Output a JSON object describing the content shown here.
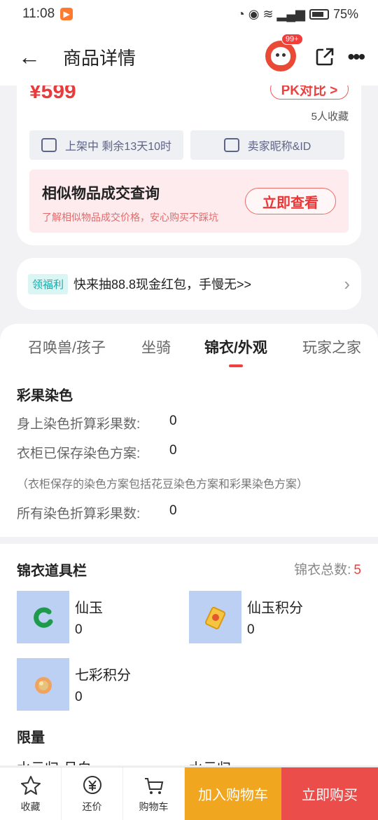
{
  "status": {
    "time": "11:08",
    "battery": "75%",
    "network": "4G"
  },
  "nav": {
    "title": "商品详情",
    "badge": "99+"
  },
  "product": {
    "price": "¥599",
    "pk_label": "PK对比 >",
    "fav_count": "5人收藏",
    "listing_status": "上架中 剩余13天10时",
    "seller": "卖家昵称&ID"
  },
  "similar": {
    "title": "相似物品成交查询",
    "subtitle": "了解相似物品成交价格，安心购买不踩坑",
    "button": "立即查看"
  },
  "promo": {
    "tag": "领福利",
    "text": "快来抽88.8现金红包，手慢无>>"
  },
  "tabs": [
    {
      "label": "召唤兽/孩子"
    },
    {
      "label": "坐骑"
    },
    {
      "label": "锦衣/外观"
    },
    {
      "label": "玩家之家"
    }
  ],
  "dye": {
    "title": "彩果染色",
    "rows": [
      {
        "label": "身上染色折算彩果数:",
        "value": "0"
      },
      {
        "label": "衣柜已保存染色方案:",
        "value": "0"
      },
      {
        "label": "所有染色折算彩果数:",
        "value": "0"
      }
    ],
    "note": "（衣柜保存的染色方案包括花豆染色方案和彩果染色方案）"
  },
  "wardrobe": {
    "title": "锦衣道具栏",
    "total_label": "锦衣总数:",
    "total_value": "5",
    "items": [
      {
        "name": "仙玉",
        "value": "0",
        "icon": "jade-icon"
      },
      {
        "name": "仙玉积分",
        "value": "0",
        "icon": "jade-points-icon"
      },
      {
        "name": "七彩积分",
        "value": "0",
        "icon": "rainbow-points-icon"
      }
    ],
    "limited_title": "限量",
    "partial_1": "水云归·月白",
    "partial_2": "水云归"
  },
  "bottom": {
    "fav": "收藏",
    "bargain": "还价",
    "cart": "购物车",
    "add_cart": "加入购物车",
    "buy_now": "立即购买"
  }
}
